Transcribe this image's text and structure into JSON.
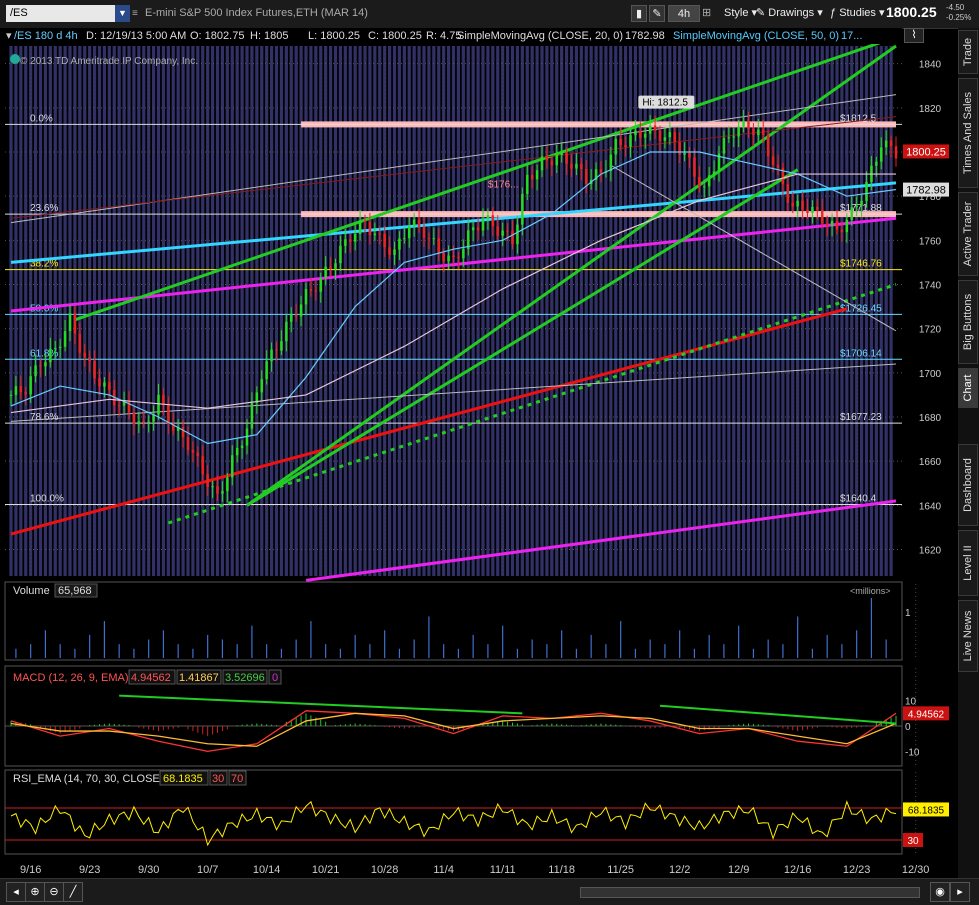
{
  "toolbar": {
    "symbol": "/ES",
    "title": "E-mini S&P 500 Index Futures,ETH (MAR 14)",
    "timeframe": "4h",
    "style_label": "Style",
    "drawings_label": "Drawings",
    "studies_label": "Studies",
    "last_price": "1800.25",
    "change_abs": "-4.50",
    "change_pct": "-0.25%"
  },
  "infobar": {
    "symbol_period": "/ES 180 d 4h",
    "date": "D: 12/19/13 5:00 AM",
    "open": "O: 1802.75",
    "high": "H: 1805",
    "low": "L: 1800.25",
    "close": "C: 1800.25",
    "range": "R: 4.75",
    "sma20_label": "SimpleMovingAvg (CLOSE, 20, 0)",
    "sma20_value": "1782.98",
    "sma50_label": "SimpleMovingAvg (CLOSE, 50, 0)",
    "sma50_value": "17..."
  },
  "copyright": "© 2013 TD Ameritrade IP Company, Inc.",
  "side_tabs": [
    "Trade",
    "Times And Sales",
    "Active Trader",
    "Big Buttons",
    "Chart",
    "Dashboard",
    "Level II",
    "Live News"
  ],
  "colors": {
    "bg": "#000000",
    "period_band": "#3a3a7a",
    "green": "#22cc22",
    "cyan": "#33d6ff",
    "magenta": "#ee22ee",
    "red": "#ee1111",
    "pink": "#ffb6b6",
    "yellow": "#ffee00"
  },
  "chart_data": [
    {
      "type": "line",
      "title": "",
      "xlabel": "",
      "ylabel": "",
      "ylim": [
        1608,
        1848
      ],
      "x_tick_labels": [
        "9/16",
        "9/23",
        "9/30",
        "10/7",
        "10/14",
        "10/21",
        "10/28",
        "11/4",
        "11/11",
        "11/18",
        "11/25",
        "12/2",
        "12/9",
        "12/16",
        "12/23",
        "12/30"
      ],
      "y_ticks": [
        1620,
        1640,
        1660,
        1680,
        1700,
        1720,
        1740,
        1760,
        1780,
        1800,
        1820,
        1840
      ],
      "grid": true,
      "hi_label": "Hi: 1812.5",
      "last_price_label": "1800.25",
      "sma20_label": "1782.98",
      "fib_levels": [
        {
          "pct": "0.0%",
          "price_label": "$1812.5",
          "value": 1812.5
        },
        {
          "pct": "23.6%",
          "price_label": "$1771.88",
          "value": 1771.88
        },
        {
          "pct": "38.2%",
          "price_label": "$1746.76",
          "value": 1746.76
        },
        {
          "pct": "50.0%",
          "price_label": "$1726.45",
          "value": 1726.45
        },
        {
          "pct": "61.8%",
          "price_label": "$1706.14",
          "value": 1706.14
        },
        {
          "pct": "78.6%",
          "price_label": "$1677.23",
          "value": 1677.23
        },
        {
          "pct": "100.0%",
          "price_label": "$1640.4",
          "value": 1640.4
        }
      ],
      "annotation_mid": "$176...",
      "series": [
        {
          "kind": "price",
          "x": [
            0,
            3,
            6,
            9,
            12,
            15,
            18,
            21,
            24,
            27,
            30,
            33,
            36,
            39,
            42,
            45,
            48,
            51,
            54,
            57,
            60,
            63,
            66,
            69,
            72,
            75,
            78,
            81,
            84,
            87,
            90,
            93,
            96,
            99,
            102,
            105,
            108,
            111,
            114,
            117,
            120,
            123,
            126,
            129,
            132,
            135,
            138,
            141,
            144,
            147,
            150,
            153,
            156,
            159,
            162,
            165,
            168,
            171,
            174,
            177,
            180
          ],
          "values": [
            1690,
            1693,
            1705,
            1710,
            1724,
            1706,
            1696,
            1688,
            1682,
            1675,
            1688,
            1675,
            1668,
            1655,
            1643,
            1660,
            1675,
            1700,
            1712,
            1725,
            1735,
            1742,
            1752,
            1762,
            1768,
            1760,
            1754,
            1768,
            1764,
            1755,
            1750,
            1762,
            1770,
            1765,
            1760,
            1788,
            1795,
            1798,
            1795,
            1788,
            1790,
            1803,
            1806,
            1810,
            1808,
            1805,
            1795,
            1782,
            1800,
            1810,
            1812,
            1806,
            1790,
            1775,
            1775,
            1770,
            1764,
            1772,
            1785,
            1804,
            1800
          ]
        },
        {
          "kind": "sma20",
          "name": "SimpleMovingAvg (CLOSE, 20, 0)",
          "x": [
            0,
            10,
            20,
            30,
            40,
            50,
            60,
            70,
            80,
            90,
            100,
            110,
            120,
            130,
            140,
            150,
            160,
            170,
            180
          ],
          "values": [
            1685,
            1694,
            1690,
            1680,
            1668,
            1672,
            1698,
            1730,
            1750,
            1756,
            1760,
            1772,
            1790,
            1800,
            1800,
            1795,
            1790,
            1780,
            1783
          ]
        },
        {
          "kind": "sma50",
          "name": "SimpleMovingAvg (CLOSE, 50, 0)",
          "x": [
            0,
            20,
            40,
            60,
            80,
            100,
            120,
            140,
            160,
            180
          ],
          "values": [
            1682,
            1688,
            1684,
            1690,
            1712,
            1738,
            1760,
            1778,
            1790,
            1790
          ]
        }
      ],
      "trendlines": [
        {
          "color": "magenta",
          "x": [
            0,
            180
          ],
          "values": [
            1728,
            1770
          ]
        },
        {
          "color": "magenta",
          "x": [
            60,
            180
          ],
          "values": [
            1606,
            1642
          ]
        },
        {
          "color": "cyan",
          "x": [
            0,
            180
          ],
          "values": [
            1750,
            1786
          ]
        },
        {
          "color": "red",
          "x": [
            0,
            170
          ],
          "values": [
            1627,
            1729
          ]
        },
        {
          "color": "green",
          "x": [
            13,
            180
          ],
          "values": [
            1724,
            1852
          ]
        },
        {
          "color": "green",
          "x": [
            48,
            180
          ],
          "values": [
            1640,
            1848
          ]
        },
        {
          "color": "green",
          "x": [
            48,
            160
          ],
          "values": [
            1640,
            1792
          ]
        },
        {
          "color": "green_dotted",
          "x": [
            32,
            180
          ],
          "values": [
            1632,
            1740
          ]
        },
        {
          "color": "silver",
          "x": [
            0,
            180
          ],
          "values": [
            1768,
            1826
          ]
        },
        {
          "color": "silver",
          "x": [
            0,
            180
          ],
          "values": [
            1678,
            1704
          ]
        },
        {
          "color": "silver",
          "x": [
            122,
            180
          ],
          "values": [
            1794,
            1719
          ]
        },
        {
          "color": "darkred",
          "x": [
            0,
            180
          ],
          "values": [
            1770,
            1816
          ]
        }
      ],
      "zones": [
        {
          "color": "pink",
          "x": [
            59,
            180
          ],
          "value": 1812.5
        },
        {
          "color": "pink",
          "x": [
            59,
            180
          ],
          "value": 1771.88
        }
      ]
    },
    {
      "type": "bar",
      "title": "Volume",
      "value_label": "65,968",
      "unit_label": "<millions>",
      "y_ticks": [
        1
      ],
      "ylim": [
        0,
        1.3
      ],
      "values": [
        0.2,
        0.3,
        0.6,
        0.3,
        0.2,
        0.5,
        0.8,
        0.3,
        0.2,
        0.4,
        0.6,
        0.3,
        0.2,
        0.5,
        0.4,
        0.3,
        0.7,
        0.3,
        0.2,
        0.4,
        0.8,
        0.3,
        0.2,
        0.5,
        0.3,
        0.6,
        0.2,
        0.4,
        0.9,
        0.3,
        0.2,
        0.5,
        0.3,
        0.7,
        0.2,
        0.4,
        0.3,
        0.6,
        0.2,
        0.5,
        0.3,
        0.8,
        0.2,
        0.4,
        0.3,
        0.6,
        0.2,
        0.5,
        0.3,
        0.7,
        0.2,
        0.4,
        0.3,
        0.9,
        0.2,
        0.5,
        0.3,
        0.6,
        1.3,
        0.4
      ]
    },
    {
      "type": "line",
      "title": "MACD (12, 26, 9, EMA)",
      "value_labels": [
        "4.94562",
        "1.41867",
        "3.52696",
        "0"
      ],
      "right_value": "4.94562",
      "y_ticks": [
        10,
        0,
        -10
      ],
      "ylim": [
        -15,
        15
      ],
      "series": [
        {
          "kind": "macd",
          "x": [
            0,
            10,
            20,
            30,
            40,
            50,
            60,
            70,
            80,
            90,
            100,
            110,
            120,
            130,
            140,
            150,
            160,
            170,
            180
          ],
          "values": [
            2,
            -4,
            -1,
            -6,
            -10,
            -7,
            6,
            5,
            3,
            -3,
            4,
            3,
            5,
            2,
            -3,
            -1,
            -6,
            -8,
            5
          ]
        },
        {
          "kind": "signal",
          "x": [
            0,
            10,
            20,
            30,
            40,
            50,
            60,
            70,
            80,
            90,
            100,
            110,
            120,
            130,
            140,
            150,
            160,
            170,
            180
          ],
          "values": [
            1,
            -2,
            -2,
            -4,
            -7,
            -8,
            2,
            5,
            4,
            -1,
            2,
            3,
            4,
            3,
            -1,
            -1,
            -4,
            -7,
            1
          ]
        }
      ],
      "histogram": [
        2,
        -3,
        1,
        -2,
        -4,
        1,
        5,
        1,
        -1,
        -2,
        2,
        1,
        1,
        -1,
        -2,
        1,
        -2,
        -1,
        4
      ],
      "trendlines": [
        {
          "x": [
            22,
            104
          ],
          "values": [
            12,
            5
          ]
        },
        {
          "x": [
            132,
            180
          ],
          "values": [
            8,
            1
          ]
        }
      ]
    },
    {
      "type": "line",
      "title": "RSI_EMA (14, 70, 30, CLOSE)",
      "value_labels": [
        "68.1835",
        "30",
        "70"
      ],
      "right_values": [
        "68.1835",
        "30"
      ],
      "ylim": [
        15,
        95
      ],
      "overbought": 70,
      "oversold": 30,
      "series": [
        {
          "kind": "rsi",
          "x": [
            0,
            5,
            10,
            15,
            20,
            25,
            30,
            35,
            40,
            45,
            50,
            55,
            60,
            65,
            70,
            75,
            80,
            85,
            90,
            95,
            100,
            105,
            110,
            115,
            120,
            125,
            130,
            135,
            140,
            145,
            150,
            155,
            160,
            165,
            170,
            175,
            180
          ],
          "values": [
            60,
            45,
            70,
            35,
            55,
            65,
            40,
            72,
            30,
            50,
            62,
            48,
            74,
            58,
            45,
            68,
            52,
            40,
            65,
            55,
            70,
            48,
            60,
            44,
            66,
            52,
            72,
            58,
            46,
            62,
            68,
            40,
            60,
            35,
            70,
            55,
            68
          ]
        }
      ]
    }
  ]
}
